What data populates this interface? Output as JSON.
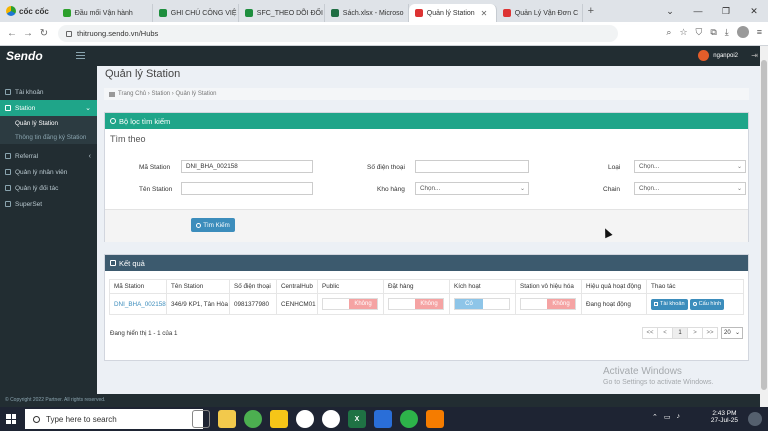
{
  "browser": {
    "brand": "cốc cốc",
    "tabs": [
      {
        "label": "Đầu mối Vận hành",
        "color": "#2ca02c"
      },
      {
        "label": "GHI CHÚ CÔNG VIỆ",
        "color": "#1e8e3e"
      },
      {
        "label": "SFC_THEO DÕI ĐỐI",
        "color": "#1e8e3e"
      },
      {
        "label": "Sách.xlsx - Microso",
        "color": "#1f6e43"
      },
      {
        "label": "Quản lý Station",
        "color": "#d33"
      },
      {
        "label": "Quản Lý Vận Đơn C",
        "color": "#d33"
      }
    ],
    "active_tab_index": 4,
    "url": "thitruong.sendo.vn/Hubs"
  },
  "app": {
    "logo": "Sendo",
    "username": "nganpoi2"
  },
  "sidebar": {
    "items": [
      {
        "label": "Tài khoản",
        "icon": "user-icon",
        "active": false
      },
      {
        "label": "Station",
        "icon": "bank-icon",
        "active": true
      },
      {
        "label": "Referral",
        "icon": "share-icon",
        "active": false
      },
      {
        "label": "Quản lý nhân viên",
        "icon": "user-edit-icon",
        "active": false
      },
      {
        "label": "Quản lý đối tác",
        "icon": "user-edit-icon",
        "active": false
      },
      {
        "label": "SuperSet",
        "icon": "chart-icon",
        "active": false
      }
    ],
    "sub_items": [
      {
        "label": "Quản lý Station",
        "active": true
      },
      {
        "label": "Thông tin đăng ký Station",
        "active": false
      }
    ]
  },
  "page": {
    "title": "Quản lý Station",
    "breadcrumb": "Trang Chủ › Station › Quản lý Station"
  },
  "filter": {
    "header": "Bộ lọc tìm kiếm",
    "subtitle": "Tìm theo",
    "ma_station_label": "Mã Station",
    "ma_station_value": "DNI_BHA_002158",
    "ten_station_label": "Tên Station",
    "ten_station_value": "",
    "so_dien_thoai_label": "Số điện thoại",
    "so_dien_thoai_value": "",
    "kho_hang_label": "Kho hàng",
    "kho_hang_value": "Chọn...",
    "loai_label": "Loại",
    "loai_value": "Chọn...",
    "chain_label": "Chain",
    "chain_value": "Chọn...",
    "search_button": "Tìm Kiếm"
  },
  "results": {
    "header": "Kết quả",
    "columns": [
      "Mã Station",
      "Tên Station",
      "Số điện thoại",
      "CentralHub",
      "Public",
      "Đặt hàng",
      "Kích hoạt",
      "Station vô hiệu hóa",
      "Hiệu quả hoạt động",
      "Thao tác"
    ],
    "rows": [
      {
        "ma_station": "DNI_BHA_002158",
        "ten_station": "346/9 KP1, Tân Hòa",
        "so_dien_thoai": "0981377980",
        "central_hub": "CENHCM01",
        "public": "Không",
        "dat_hang": "Không",
        "kich_hoat": "Có",
        "vo_hieu_hoa": "Không",
        "hieu_qua": "Đang hoạt động",
        "btn_tai_khoan": "Tài khoản",
        "btn_cau_hinh": "Cấu hình"
      }
    ],
    "showing": "Đang hiển thị 1 - 1 của 1",
    "pager": [
      "<<",
      "<",
      "1",
      ">",
      ">>"
    ],
    "current_page": "1",
    "page_size": "20"
  },
  "footer": {
    "copyright": "© Copyright 2022 Partner. All rights reserved."
  },
  "watermark": {
    "line1": "Activate Windows",
    "line2": "Go to Settings to activate Windows."
  },
  "taskbar": {
    "search_placeholder": "Type here to search",
    "time": "2:43 PM",
    "date": "27-Jul-25"
  },
  "colors": {
    "accent": "#1fa589",
    "sidebar_bg": "#222d32",
    "primary_button": "#3c8dbc",
    "toggle_off": "#f5a3a3",
    "toggle_on": "#8ec5e8"
  }
}
